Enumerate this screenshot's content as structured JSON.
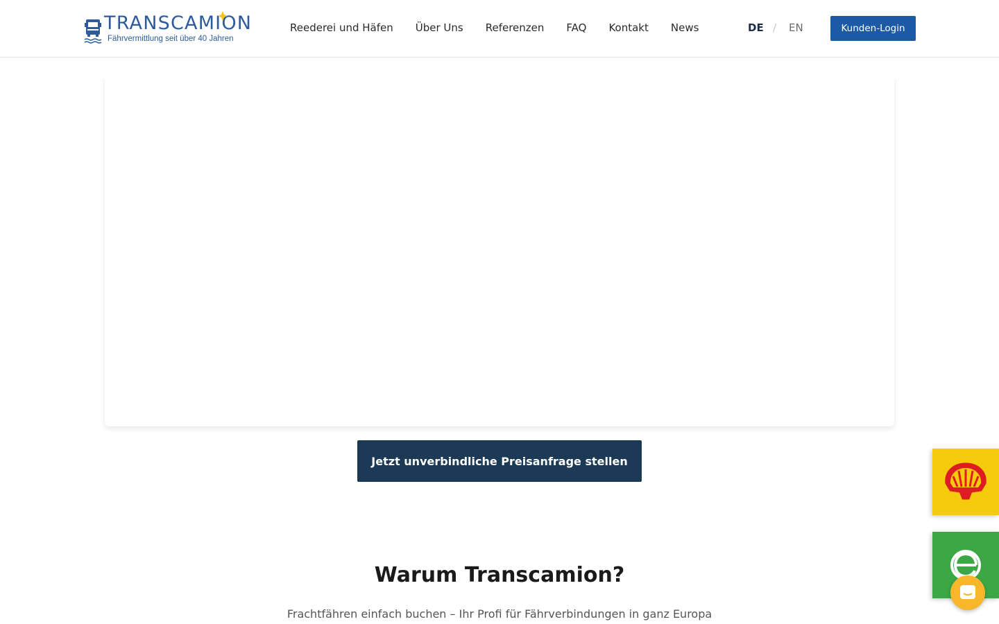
{
  "header": {
    "logo": {
      "word": "TRANSCAMION",
      "tagline": "Fährvermittlung seit über 40 Jahren",
      "brand_color": "#2d5b9c"
    },
    "nav": [
      {
        "label": "Reederei und Häfen"
      },
      {
        "label": "Über Uns"
      },
      {
        "label": "Referenzen"
      },
      {
        "label": "FAQ"
      },
      {
        "label": "Kontakt"
      },
      {
        "label": "News"
      }
    ],
    "language": {
      "active": "DE",
      "separator": "/",
      "other": "EN"
    },
    "login_label": "Kunden-Login"
  },
  "main": {
    "cta_label": "Jetzt unverbindliche Preisanfrage stellen",
    "section_title": "Warum Transcamion?",
    "section_subtitle": "Frachtfähren einfach buchen – Ihr Profi für Fährverbindungen in ganz Europa"
  },
  "side_widgets": [
    {
      "icon": "shell-icon",
      "color": "#f6cb0c"
    },
    {
      "icon": "e-icon",
      "color": "#3ca845"
    }
  ],
  "chat": {
    "icon": "chat-icon",
    "color": "#f8b62b"
  },
  "colors": {
    "accent": "#1c5aa6",
    "cta": "#1c3a55"
  }
}
